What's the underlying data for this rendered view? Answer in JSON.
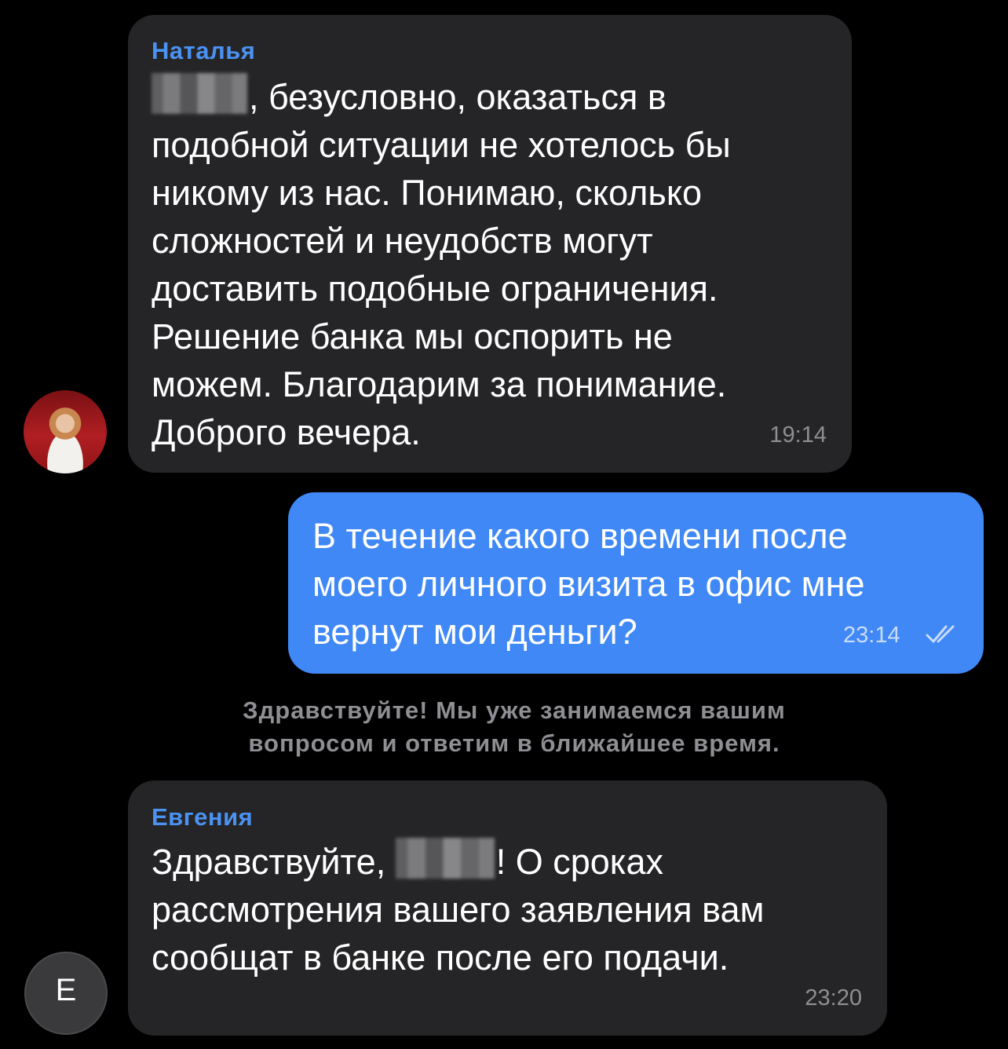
{
  "messages": [
    {
      "sender": "Наталья",
      "text_after_redaction": ", безусловно, оказаться в\nподобной ситуации не хотелось бы\nникому из нас. Понимаю, сколько\nсложностей и неудобств могут\nдоставить подобные ограничения.\nРешение банка мы оспорить не\nможем. Благодарим за понимание.\nДоброго вечера.",
      "time": "19:14",
      "avatar": "photo"
    },
    {
      "text": "В течение какого времени после\nмоего личного визита в офис мне\nвернут мои деньги?",
      "time": "23:14",
      "status_icon": "double-check-icon"
    },
    {
      "text_before_redaction": "Здравствуйте, ",
      "text_after_redaction": "! О сроках\nрассмотрения вашего заявления вам\nсообщат в банке после его подачи.",
      "sender": "Евгения",
      "time": "23:20",
      "avatar_letter": "E"
    }
  ],
  "system_message": "Здравствуйте! Мы уже занимаемся вашим\nвопросом и ответим в ближайшее время.",
  "colors": {
    "background": "#000000",
    "incoming_bubble": "#252527",
    "outgoing_bubble": "#3f88f6",
    "sender_name": "#4b92f2"
  }
}
